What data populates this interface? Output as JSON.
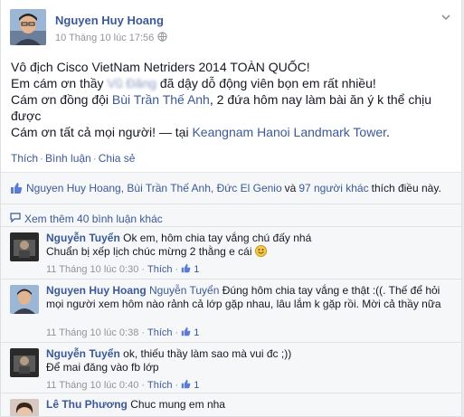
{
  "post": {
    "author": "Nguyen Huy Hoang",
    "timestamp": "10 Tháng 10 lúc 17:56",
    "lines": [
      "Vô địch Cisco VietNam Netriders 2014 TOÀN QUỐC!",
      "Em cám ơn thầy",
      "Cám ơn đồng đội",
      "Cám ơn tất cả mọi người! — tại"
    ],
    "line2_blurred": "Vũ Đăng",
    "line2_rest": "đã dậy dỗ động viên bọn em rất nhiều!",
    "teammate": "Bùi Trần Thế Anh",
    "line3_rest": ", 2 đứa hôm nay làm bài ăn ý k thể chịu được",
    "location": "Keangnam Hanoi Landmark Tower",
    "location_end": "."
  },
  "actions": {
    "like": "Thích",
    "comment": "Bình luận",
    "share": "Chia sẻ"
  },
  "likes": {
    "names": "Nguyen Huy Hoang, Bùi Trần Thế Anh, Đức El Genio",
    "and": "và",
    "others": "97 người khác",
    "suffix": "thích điều này."
  },
  "view_more": "Xem thêm 40 bình luận khác",
  "comments": [
    {
      "author": "Nguyễn Tuyển",
      "text": "Ok em, hôm chia tay vắng chú đấy nhá",
      "text2": "Chuẩn bị xếp lịch chúc mừng 2 thằng e cái",
      "time": "11 Tháng 10 lúc 0:30",
      "like": "Thích",
      "likes": "1"
    },
    {
      "author": "Nguyen Huy Hoang",
      "mention": "Nguyễn Tuyển",
      "text": "Đúng hôm chia tay vắng e thật :((. Thế để hỏi mọi người xem hôm nào rảnh cả lớp gặp nhau, lâu lắm k gặp rồi. Mời cả thầy nữa",
      "time": "11 Tháng 10 lúc 0:38",
      "like": "Thích",
      "likes": "1"
    },
    {
      "author": "Nguyễn Tuyển",
      "text": "ok, thiếu thầy làm sao mà vui đc ;))",
      "text2": "Để mai đăng vào fb lớp",
      "time": "11 Tháng 10 lúc 0:40",
      "like": "Thích",
      "likes": "1"
    },
    {
      "author": "Lê Thu Phương",
      "text": "Chuc mung em nha"
    }
  ]
}
